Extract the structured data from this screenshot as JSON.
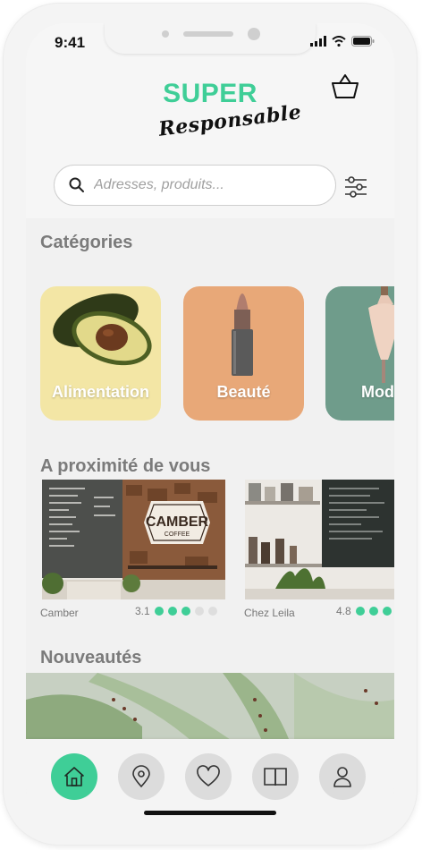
{
  "status_bar": {
    "time": "9:41"
  },
  "header": {
    "logo_top": "SUPER",
    "logo_bottom": "Responsable"
  },
  "search": {
    "placeholder": "Adresses, produits..."
  },
  "sections": {
    "categories": "Catégories",
    "nearby": "A proximité de vous",
    "new": "Nouveautés"
  },
  "categories": [
    {
      "label": "Alimentation",
      "color": "#f3e6a5"
    },
    {
      "label": "Beauté",
      "color": "#e8a878"
    },
    {
      "label": "Mod",
      "color": "#6f9c8b"
    }
  ],
  "places": [
    {
      "name": "Camber",
      "rating": "3.1",
      "sign_line1": "CAMBER",
      "sign_line2": "COFFEE",
      "filled": 3,
      "total": 5
    },
    {
      "name": "Chez Leila",
      "rating": "4.8",
      "filled": 3,
      "total": 3
    }
  ],
  "tabs": [
    "home-icon",
    "location-pin-icon",
    "heart-icon",
    "book-icon",
    "user-icon"
  ],
  "colors": {
    "accent": "#3fce97",
    "inactive_tab": "#dcdcdc",
    "dot_empty": "#dedede"
  }
}
